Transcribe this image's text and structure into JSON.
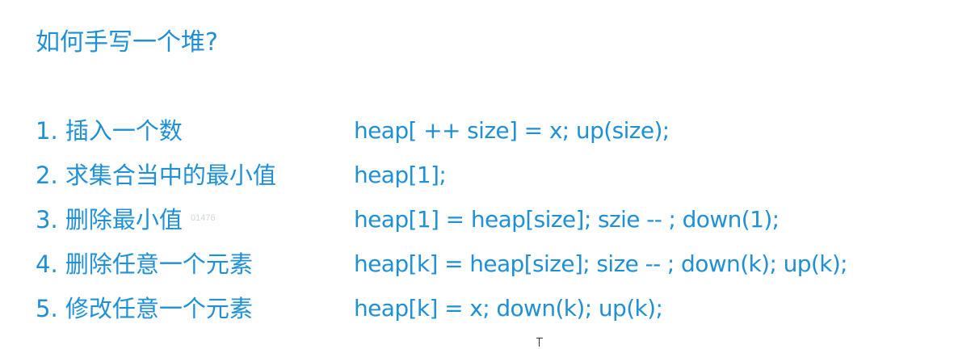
{
  "slide": {
    "title": "如何手写一个堆?",
    "items": [
      {
        "label": "1. 插入一个数",
        "code": "heap[ ++ size] = x; up(size);"
      },
      {
        "label": "2. 求集合当中的最小值",
        "code": "heap[1];"
      },
      {
        "label": "3. 删除最小值",
        "code": "heap[1] = heap[size]; szie -- ; down(1);"
      },
      {
        "label": "4. 删除任意一个元素",
        "code": "heap[k] = heap[size]; size -- ; down(k); up(k);"
      },
      {
        "label": "5. 修改任意一个元素",
        "code": "heap[k] = x; down(k); up(k);"
      }
    ],
    "watermark": "01476"
  },
  "colors": {
    "text": "#1f8fd6",
    "background": "#ffffff"
  },
  "icons": {
    "cursor": "text-cursor-icon"
  }
}
